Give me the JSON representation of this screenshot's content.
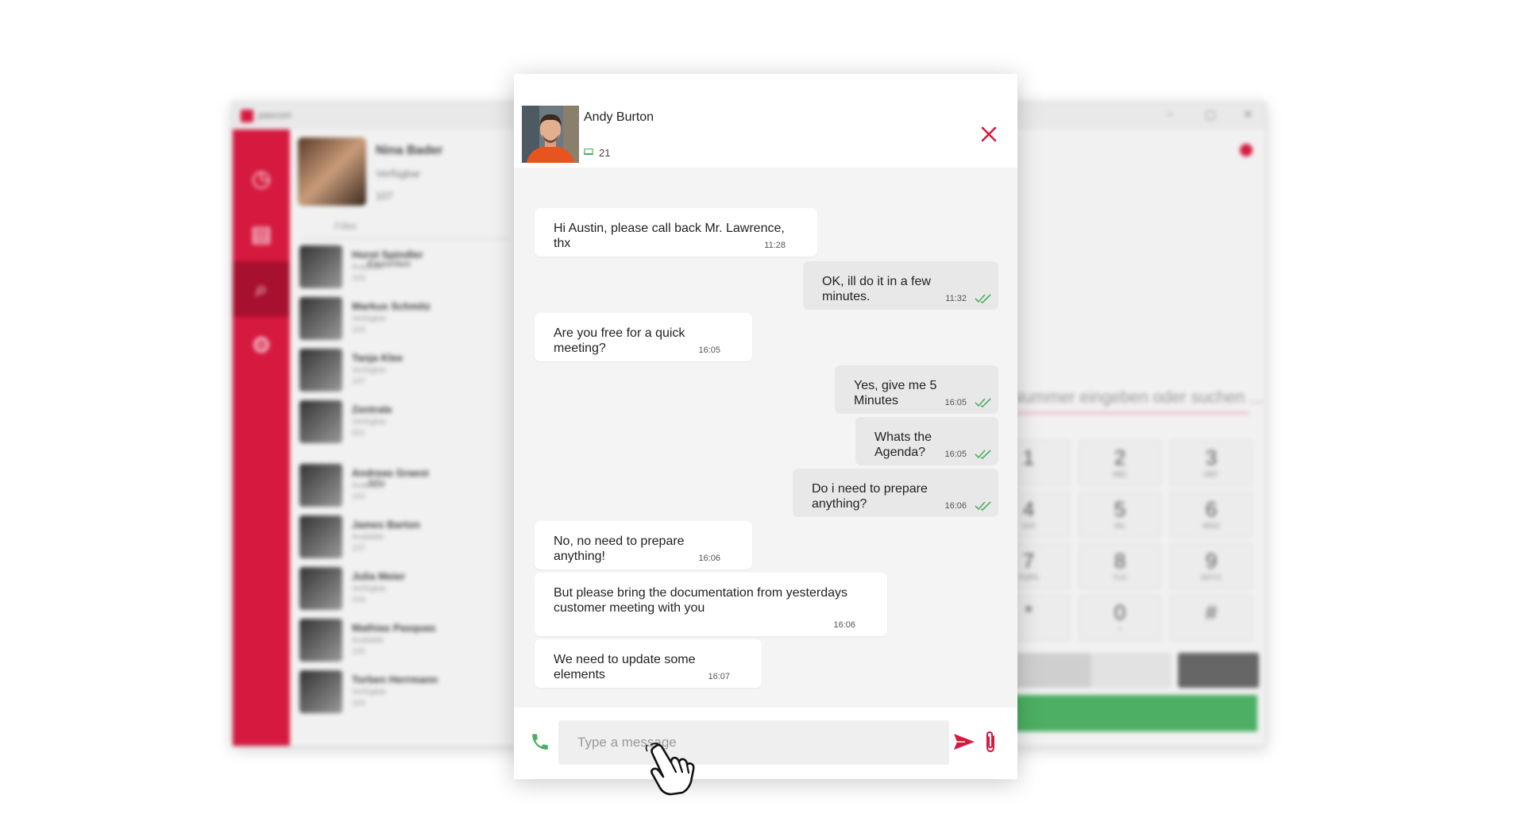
{
  "background_app": {
    "app_name": "pascom",
    "profile": {
      "name": "Nina Bader",
      "status": "Verfügbar",
      "extension": "107"
    },
    "search_placeholder": "Filter",
    "favorites_label": "Favoriten",
    "all_label": "Alle",
    "contacts": [
      {
        "name": "Horst Spindler",
        "status": "Available",
        "ext": "103"
      },
      {
        "name": "Markus Schmitz",
        "status": "Verfügbar",
        "ext": "103"
      },
      {
        "name": "Tanja Klee",
        "status": "Verfügbar",
        "ext": "107"
      },
      {
        "name": "Zentrale",
        "status": "Verfügbar",
        "ext": "001"
      },
      {
        "name": "Andreas Graest",
        "status": "Available",
        "ext": "102"
      },
      {
        "name": "James Barton",
        "status": "Available",
        "ext": "107"
      },
      {
        "name": "Julia Meier",
        "status": "Verfügbar",
        "ext": "218"
      },
      {
        "name": "Mathias Pasquas",
        "status": "Available",
        "ext": "103"
      },
      {
        "name": "Torben Herrmann",
        "status": "Verfügbar",
        "ext": "104"
      }
    ],
    "dial_hint": "Nummer eingeben oder suchen ...",
    "keypad": [
      {
        "digit": "1",
        "letters": ""
      },
      {
        "digit": "2",
        "letters": "ABC"
      },
      {
        "digit": "3",
        "letters": "DEF"
      },
      {
        "digit": "4",
        "letters": "GHI"
      },
      {
        "digit": "5",
        "letters": "JKL"
      },
      {
        "digit": "6",
        "letters": "MNO"
      },
      {
        "digit": "7",
        "letters": "PQRS"
      },
      {
        "digit": "8",
        "letters": "TUV"
      },
      {
        "digit": "9",
        "letters": "WXYZ"
      },
      {
        "digit": "*",
        "letters": ""
      },
      {
        "digit": "0",
        "letters": "+"
      },
      {
        "digit": "#",
        "letters": ""
      }
    ]
  },
  "chat": {
    "contact_name": "Andy Burton",
    "extension": "21",
    "messages": [
      {
        "dir": "in",
        "text": "Hi Austin, please call back Mr. Lawrence, thx",
        "time": "11:28"
      },
      {
        "dir": "out",
        "text": "OK, ill do it in a few minutes.",
        "time": "11:32",
        "read": true
      },
      {
        "dir": "in",
        "text": "Are you free for a quick meeting?",
        "time": "16:05"
      },
      {
        "dir": "out",
        "text": "Yes, give me 5 Minutes",
        "time": "16:05",
        "read": true
      },
      {
        "dir": "out",
        "text": "Whats the Agenda?",
        "time": "16:05",
        "read": true
      },
      {
        "dir": "out",
        "text": "Do i need to prepare anything?",
        "time": "16:06",
        "read": true
      },
      {
        "dir": "in",
        "text": "No, no need to prepare anything!",
        "time": "16:06"
      },
      {
        "dir": "in",
        "text": "But please bring the documentation from yesterdays customer meeting with you",
        "time": "16:06"
      },
      {
        "dir": "in",
        "text": "We need to update some elements",
        "time": "16:07"
      }
    ],
    "input_placeholder": "Type a message",
    "input_value": ""
  },
  "colors": {
    "brand_red": "#d6193f",
    "call_green": "#4caf63",
    "read_check": "#4caf63",
    "incoming_bubble": "#ffffff",
    "outgoing_bubble": "#e8e8e8"
  }
}
